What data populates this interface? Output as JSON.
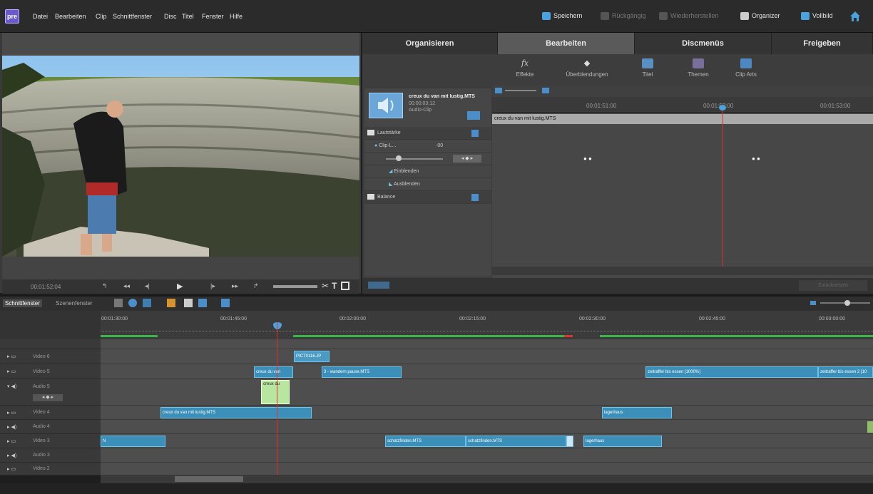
{
  "app": {
    "logo": "pre"
  },
  "menu": [
    "Datei",
    "Bearbeiten",
    "Clip",
    "Schnittfenster",
    "Disc",
    "Titel",
    "Fenster",
    "Hilfe"
  ],
  "toolbar": {
    "save": "Speichern",
    "undo": "Rückgängig",
    "redo": "Wiederherstellen",
    "organizer": "Organizer",
    "fullscreen": "Vollbild"
  },
  "preview": {
    "timecode": "00:01:52:04"
  },
  "right_tabs": [
    "Organisieren",
    "Bearbeiten",
    "Discmenüs",
    "Freigeben"
  ],
  "active_tab": "Bearbeiten",
  "tools": [
    "Effekte",
    "Überblendungen",
    "Titel",
    "Themen",
    "Clip Arts"
  ],
  "clip_info": {
    "name": "creux du van mit lustig.MTS",
    "duration": "00:00:03:12",
    "type": "Audio-Clip"
  },
  "properties": {
    "volume": "Lautstärke",
    "clip_level": "Clip-L...",
    "clip_level_value": "-00",
    "fade_in": "Einblenden",
    "fade_out": "Ausblenden",
    "balance": "Balance"
  },
  "keyframe_ruler": [
    "00:01:51:00",
    "00:01:52:00",
    "00:01:53:00"
  ],
  "keyframe_clip": "creux du van mit lustig.MTS",
  "panel_button": "Zurücksetzen",
  "timeline": {
    "view_tabs": [
      "Schnittfenster",
      "Szenenfenster"
    ],
    "ruler": [
      "00:01:30:00",
      "00:01:45:00",
      "00:02:00:00",
      "00:02:15:00",
      "00:02:30:00",
      "00:02:45:00",
      "00:03:00:00"
    ],
    "tracks": [
      "Video 6",
      "Video 5",
      "Audio 5",
      "Video 4",
      "Audio 4",
      "Video 3",
      "Audio 3",
      "Video 2"
    ],
    "clips": {
      "v6_1": "PICT0116.JP",
      "v5_1": "creux du van",
      "v5_2": "3 - wandern pause.MTS",
      "v5_3": "zeitraffer bis essen [1000%]",
      "v5_4": "zeitraffer bis essen 2 [10",
      "a5_1": "creux du",
      "v4_1": "creux du van mit lustig.MTS",
      "v4_2": "lagerhaus",
      "v3_1": "N",
      "v3_2": "schatzfinden.MTS",
      "v3_3": "schatzfinden.MTS",
      "v3_4": "lagerhaus"
    }
  }
}
